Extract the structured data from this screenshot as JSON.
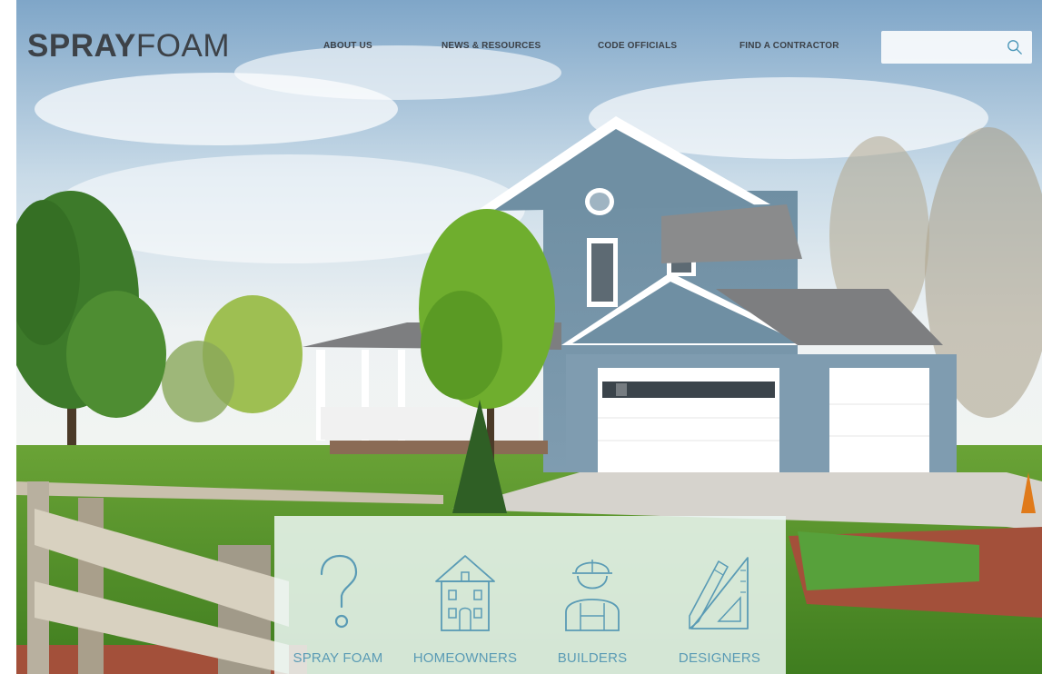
{
  "logo": {
    "bold": "SPRAY",
    "light": "FOAM"
  },
  "nav": [
    {
      "label": "ABOUT US"
    },
    {
      "label": "NEWS & RESOURCES"
    },
    {
      "label": "CODE OFFICIALS"
    },
    {
      "label": "FIND A CONTRACTOR"
    }
  ],
  "search": {
    "placeholder": "",
    "value": "",
    "icon": "search-icon"
  },
  "audiences": [
    {
      "label": "SPRAY FOAM",
      "icon": "question-mark-icon"
    },
    {
      "label": "HOMEOWNERS",
      "icon": "house-icon"
    },
    {
      "label": "BUILDERS",
      "icon": "builder-hardhat-icon"
    },
    {
      "label": "DESIGNERS",
      "icon": "pencil-triangle-icon"
    }
  ],
  "colors": {
    "logo": "#3d4248",
    "nav_text": "#3b4047",
    "accent": "#5a9bb5",
    "panel_bg": "#ecf7f3"
  }
}
